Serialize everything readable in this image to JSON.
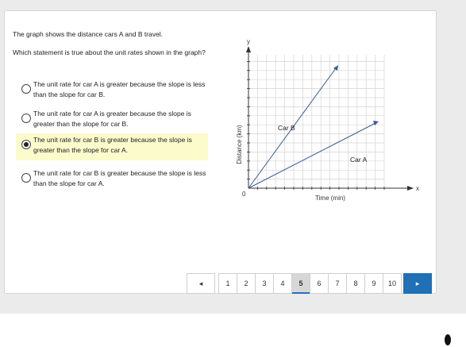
{
  "question": {
    "line1": "The graph shows the distance cars A and B travel.",
    "line2": "Which statement is true about the unit rates shown in the graph?"
  },
  "options": [
    {
      "text": "The unit rate for car A is greater because the slope is less than the slope for car B.",
      "selected": false
    },
    {
      "text": "The unit rate for car A is greater because the slope is greater than the slope for car B.",
      "selected": false
    },
    {
      "text": "The unit rate for car B is greater because the slope is greater than the slope for car A.",
      "selected": true
    },
    {
      "text": "The unit rate for car B is greater because the slope is less than the slope for car A.",
      "selected": false
    }
  ],
  "graph": {
    "y_axis_letter": "y",
    "x_axis_letter": "x",
    "origin_label": "0",
    "y_label": "Distance (km)",
    "x_label": "Time (min)",
    "car_b_label": "Car B",
    "car_a_label": "Car A",
    "line_color": "#3a5b95"
  },
  "pagination": {
    "prev_icon": "◂",
    "next_icon": "▸",
    "pages": [
      "1",
      "2",
      "3",
      "4",
      "5",
      "6",
      "7",
      "8",
      "9",
      "10"
    ],
    "current": "5"
  }
}
